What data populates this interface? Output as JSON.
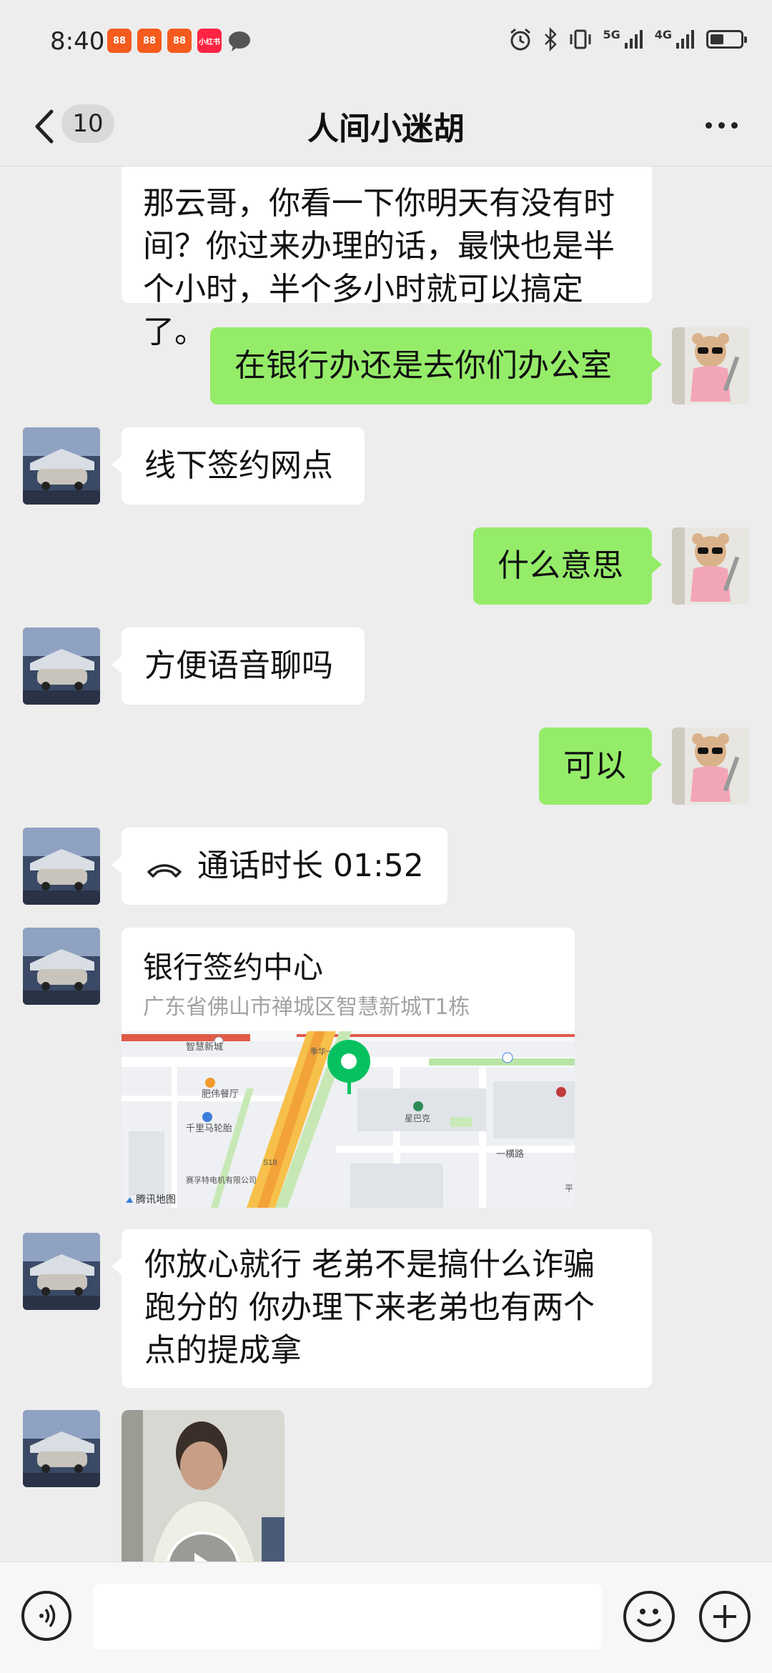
{
  "status_bar": {
    "time": "8:40",
    "notifications": [
      {
        "label": "88",
        "color": "#f45b1d"
      },
      {
        "label": "88",
        "color": "#f45b1d"
      },
      {
        "label": "88",
        "color": "#f45b1d"
      },
      {
        "label": "小红书",
        "color": "#ff2442"
      }
    ],
    "network_1": "5G",
    "network_2": "4G"
  },
  "header": {
    "unread_count": "10",
    "title": "人间小迷胡"
  },
  "messages": [
    {
      "side": "left",
      "text_lines": [
        "那云哥，你看一下你明天有没有时",
        "间？你过来办理的话，最快也是半",
        "个小时，半个多小时就可以搞定了。"
      ]
    },
    {
      "side": "right",
      "text": "在银行办还是去你们办公室"
    },
    {
      "side": "left",
      "text": "线下签约网点"
    },
    {
      "side": "right",
      "text": "什么意思"
    },
    {
      "side": "left",
      "text": "方便语音聊吗"
    },
    {
      "side": "right",
      "text": "可以"
    },
    {
      "side": "left",
      "type": "call",
      "text": "通话时长 01:52"
    },
    {
      "side": "left",
      "type": "location",
      "title": "银行签约中心",
      "address": "广东省佛山市禅城区智慧新城T1栋",
      "map_labels": [
        "智慧新城",
        "肥伟餐厅",
        "千里马轮胎",
        "星巴克",
        "一横路",
        "赛孚特电机有限公司",
        "S18",
        "季华一路",
        "平"
      ],
      "map_brand": "腾讯地图"
    },
    {
      "side": "left",
      "text_lines": [
        "你放心就行 老弟不是搞什么诈骗",
        "跑分的 你办理下来老弟也有两个",
        "点的提成拿"
      ]
    },
    {
      "side": "left",
      "type": "video"
    }
  ],
  "colors": {
    "background": "#ededed",
    "bubble_self": "#95ec69",
    "bubble_other": "#ffffff",
    "map_pin": "#07c160"
  }
}
